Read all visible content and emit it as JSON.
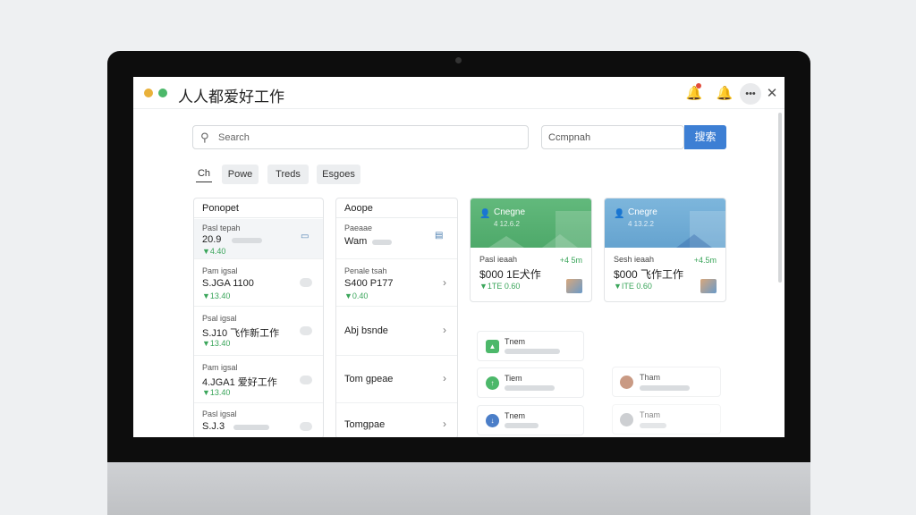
{
  "app": {
    "title": "人人都爱好工作"
  },
  "colors": {
    "accent": "#3d7fd4",
    "positive": "#3aa55a",
    "dot_yellow": "#e9b13a",
    "dot_green": "#4cb86a",
    "card1_hero": "#5fb67a",
    "card2_hero": "#73aed6"
  },
  "titlebar": {
    "bell_icon": "🔔",
    "bell2_icon": "🔔",
    "more_icon": "•••",
    "close_icon": "✕"
  },
  "search": {
    "placeholder": "Search",
    "icon": "⚲",
    "company_value": "Ccmpnah",
    "button": "搜索"
  },
  "filters": [
    "Ch",
    "Powe",
    "Treds",
    "Esgoes"
  ],
  "col1": {
    "title": "Ponopet",
    "rows": [
      {
        "small": "Pasl tepah",
        "main": "20.9",
        "change": "▼4.40"
      },
      {
        "small": "Pam igsal",
        "main": "S.JGA 1100",
        "change": "▼13.40"
      },
      {
        "small": "Psal igsal",
        "main": "S.J10 飞作新工作",
        "change": "▼13.40"
      },
      {
        "small": "Pam igsal",
        "main": "4.JGA1 爱好工作",
        "change": "▼13.40"
      },
      {
        "small": "Pasl igsal",
        "main": "S.J.3",
        "change": ""
      }
    ]
  },
  "col2": {
    "title": "Aoope",
    "rows": [
      {
        "small": "Paeaae",
        "main": "Wam",
        "change": ""
      },
      {
        "small": "Penale tsah",
        "main": "S400 P177",
        "change": "▼0.40"
      },
      {
        "small": "",
        "main": "Abj bsnde",
        "change": ""
      },
      {
        "small": "",
        "main": "Tom gpeae",
        "change": ""
      },
      {
        "small": "",
        "main": "Tomgpae",
        "change": ""
      }
    ]
  },
  "cards": [
    {
      "hero_title": "Cnegne",
      "hero_sub": "4 12.6.2",
      "small": "Pasl ieaah",
      "main": "$000 1E犬作",
      "change_right": "+4 5m",
      "change": "▼1TE 0.60"
    },
    {
      "hero_title": "Cnegre",
      "hero_sub": "4 13.2.2",
      "small": "Sesh ieaah",
      "main": "$000 飞作工作",
      "change_right": "+4.5m",
      "change": "▼ITE 0.60"
    }
  ],
  "mini_list": [
    {
      "title": "Tnem",
      "icon": "▲"
    },
    {
      "title": "Tiem",
      "icon": "↑"
    },
    {
      "title": "Tnem",
      "icon": "↓"
    }
  ],
  "mini_list2": [
    {
      "title": "Tham"
    },
    {
      "title": "Tnam"
    }
  ]
}
